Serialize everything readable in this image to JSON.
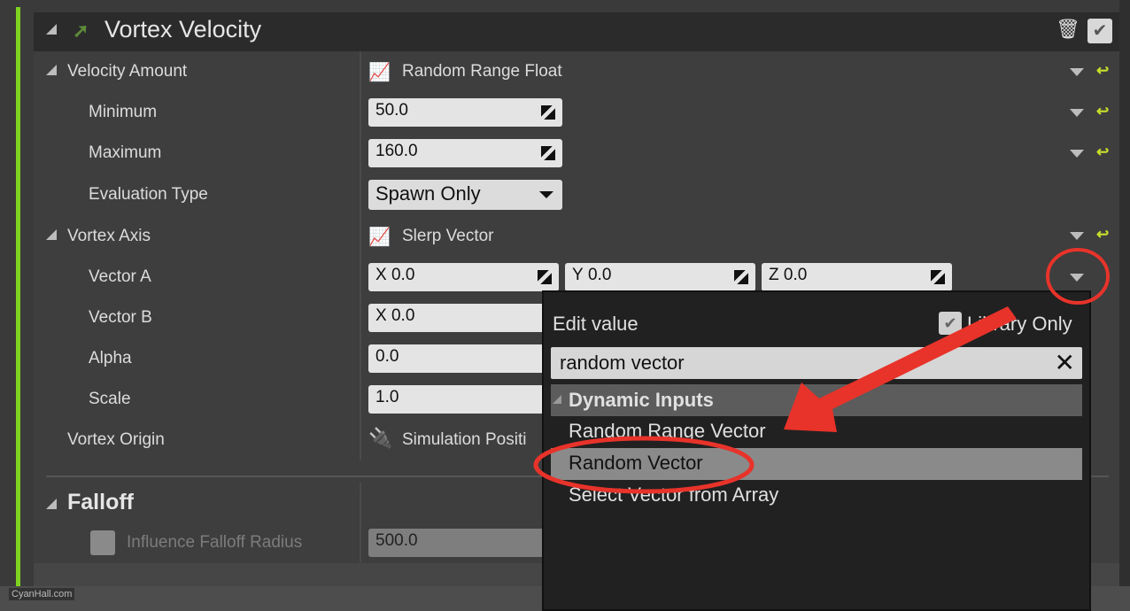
{
  "module": {
    "title": "Vortex Velocity",
    "delete_icon": "trash-icon",
    "enabled_icon": "checkbox-checked"
  },
  "rows": {
    "velocity_amount": {
      "label": "Velocity Amount",
      "value": "Random Range Float"
    },
    "minimum": {
      "label": "Minimum",
      "value": "50.0"
    },
    "maximum": {
      "label": "Maximum",
      "value": "160.0"
    },
    "evaluation_type": {
      "label": "Evaluation Type",
      "value": "Spawn Only"
    },
    "vortex_axis": {
      "label": "Vortex Axis",
      "value": "Slerp Vector"
    },
    "vector_a": {
      "label": "Vector A",
      "x": "X",
      "x_value": "0.0",
      "y": "Y",
      "y_value": "0.0",
      "z": "Z",
      "z_value": "0.0"
    },
    "vector_b": {
      "label": "Vector B",
      "x": "X",
      "x_value": "0.0"
    },
    "alpha": {
      "label": "Alpha",
      "value": "0.0"
    },
    "scale": {
      "label": "Scale",
      "value": "1.0"
    },
    "vortex_origin": {
      "label": "Vortex Origin",
      "value": "Simulation Positi"
    }
  },
  "falloff": {
    "title": "Falloff",
    "influence_label": "Influence Falloff Radius",
    "influence_value": "500.0"
  },
  "popup": {
    "title": "Edit value",
    "library_only": "Library Only",
    "search_value": "random vector",
    "category": "Dynamic Inputs",
    "items": [
      "Random Range Vector",
      "Random Vector",
      "Select Vector from Array"
    ],
    "selected": "Random Vector"
  },
  "watermark": "CyanHall.com",
  "colors": {
    "accent_green": "#7ed321",
    "link_cyan": "#1fc8e0",
    "reset_yellow": "#c8e02c",
    "annotation_red": "#e8332a"
  }
}
